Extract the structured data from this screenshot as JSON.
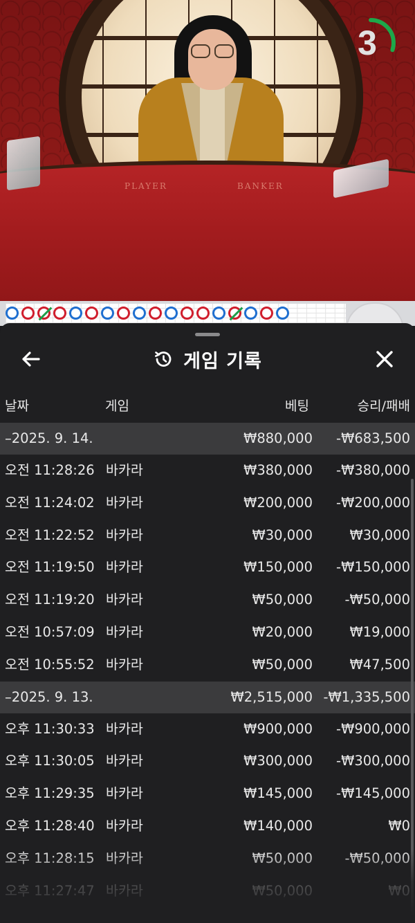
{
  "video": {
    "table_labels": {
      "player": "PLAYER",
      "banker": "BANKER"
    },
    "timer_value": "3",
    "timer_fraction": 0.3
  },
  "road": {
    "dots": [
      {
        "color": "blue",
        "tie": false
      },
      {
        "color": "red",
        "tie": false
      },
      {
        "color": "red",
        "tie": true
      },
      {
        "color": "red",
        "tie": false
      },
      {
        "color": "blue",
        "tie": false
      },
      {
        "color": "red",
        "tie": false
      },
      {
        "color": "blue",
        "tie": false
      },
      {
        "color": "red",
        "tie": false
      },
      {
        "color": "blue",
        "tie": false
      },
      {
        "color": "red",
        "tie": false
      },
      {
        "color": "blue",
        "tie": false
      },
      {
        "color": "red",
        "tie": false
      },
      {
        "color": "red",
        "tie": false
      },
      {
        "color": "blue",
        "tie": false
      },
      {
        "color": "red",
        "tie": true
      },
      {
        "color": "blue",
        "tie": false
      },
      {
        "color": "red",
        "tie": false
      },
      {
        "color": "blue",
        "tie": false
      }
    ]
  },
  "header": {
    "back_icon": "arrow-left-icon",
    "history_icon": "history-icon",
    "title": "게임 기록",
    "close_icon": "close-icon"
  },
  "columns": {
    "date": "날짜",
    "game": "게임",
    "bet": "베팅",
    "result": "승리/패배"
  },
  "groups": [
    {
      "date": "–2025. 9. 14.",
      "bet": "₩880,000",
      "result": "-₩683,500",
      "rows": [
        {
          "time": "오전 11:28:26",
          "game": "바카라",
          "bet": "₩380,000",
          "result": "-₩380,000"
        },
        {
          "time": "오전 11:24:02",
          "game": "바카라",
          "bet": "₩200,000",
          "result": "-₩200,000"
        },
        {
          "time": "오전 11:22:52",
          "game": "바카라",
          "bet": "₩30,000",
          "result": "₩30,000"
        },
        {
          "time": "오전 11:19:50",
          "game": "바카라",
          "bet": "₩150,000",
          "result": "-₩150,000"
        },
        {
          "time": "오전 11:19:20",
          "game": "바카라",
          "bet": "₩50,000",
          "result": "-₩50,000"
        },
        {
          "time": "오전 10:57:09",
          "game": "바카라",
          "bet": "₩20,000",
          "result": "₩19,000"
        },
        {
          "time": "오전 10:55:52",
          "game": "바카라",
          "bet": "₩50,000",
          "result": "₩47,500"
        }
      ]
    },
    {
      "date": "–2025. 9. 13.",
      "bet": "₩2,515,000",
      "result": "-₩1,335,500",
      "rows": [
        {
          "time": "오후 11:30:33",
          "game": "바카라",
          "bet": "₩900,000",
          "result": "-₩900,000"
        },
        {
          "time": "오후 11:30:05",
          "game": "바카라",
          "bet": "₩300,000",
          "result": "-₩300,000"
        },
        {
          "time": "오후 11:29:35",
          "game": "바카라",
          "bet": "₩145,000",
          "result": "-₩145,000"
        },
        {
          "time": "오후 11:28:40",
          "game": "바카라",
          "bet": "₩140,000",
          "result": "₩0"
        },
        {
          "time": "오후 11:28:15",
          "game": "바카라",
          "bet": "₩50,000",
          "result": "-₩50,000"
        },
        {
          "time": "오후 11:27:47",
          "game": "바카라",
          "bet": "₩50,000",
          "result": "₩0"
        }
      ]
    }
  ]
}
